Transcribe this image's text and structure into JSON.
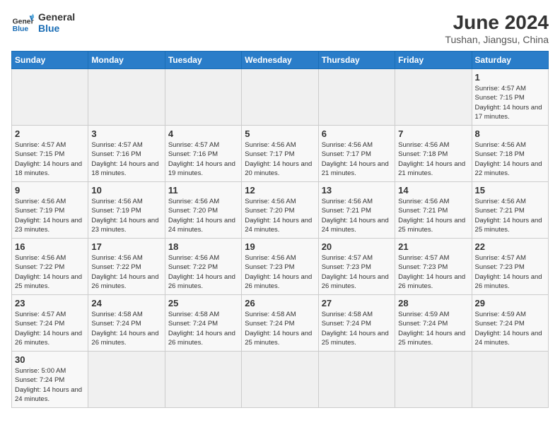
{
  "header": {
    "logo_general": "General",
    "logo_blue": "Blue",
    "title": "June 2024",
    "subtitle": "Tushan, Jiangsu, China"
  },
  "days_of_week": [
    "Sunday",
    "Monday",
    "Tuesday",
    "Wednesday",
    "Thursday",
    "Friday",
    "Saturday"
  ],
  "weeks": [
    [
      {
        "day": "",
        "info": ""
      },
      {
        "day": "",
        "info": ""
      },
      {
        "day": "",
        "info": ""
      },
      {
        "day": "",
        "info": ""
      },
      {
        "day": "",
        "info": ""
      },
      {
        "day": "",
        "info": ""
      },
      {
        "day": "1",
        "info": "Sunrise: 4:57 AM\nSunset: 7:15 PM\nDaylight: 14 hours and 17 minutes."
      }
    ],
    [
      {
        "day": "2",
        "info": "Sunrise: 4:57 AM\nSunset: 7:15 PM\nDaylight: 14 hours and 18 minutes."
      },
      {
        "day": "3",
        "info": "Sunrise: 4:57 AM\nSunset: 7:16 PM\nDaylight: 14 hours and 18 minutes."
      },
      {
        "day": "4",
        "info": "Sunrise: 4:57 AM\nSunset: 7:16 PM\nDaylight: 14 hours and 19 minutes."
      },
      {
        "day": "5",
        "info": "Sunrise: 4:56 AM\nSunset: 7:17 PM\nDaylight: 14 hours and 20 minutes."
      },
      {
        "day": "6",
        "info": "Sunrise: 4:56 AM\nSunset: 7:17 PM\nDaylight: 14 hours and 21 minutes."
      },
      {
        "day": "7",
        "info": "Sunrise: 4:56 AM\nSunset: 7:18 PM\nDaylight: 14 hours and 21 minutes."
      },
      {
        "day": "8",
        "info": "Sunrise: 4:56 AM\nSunset: 7:18 PM\nDaylight: 14 hours and 22 minutes."
      }
    ],
    [
      {
        "day": "9",
        "info": "Sunrise: 4:56 AM\nSunset: 7:19 PM\nDaylight: 14 hours and 23 minutes."
      },
      {
        "day": "10",
        "info": "Sunrise: 4:56 AM\nSunset: 7:19 PM\nDaylight: 14 hours and 23 minutes."
      },
      {
        "day": "11",
        "info": "Sunrise: 4:56 AM\nSunset: 7:20 PM\nDaylight: 14 hours and 24 minutes."
      },
      {
        "day": "12",
        "info": "Sunrise: 4:56 AM\nSunset: 7:20 PM\nDaylight: 14 hours and 24 minutes."
      },
      {
        "day": "13",
        "info": "Sunrise: 4:56 AM\nSunset: 7:21 PM\nDaylight: 14 hours and 24 minutes."
      },
      {
        "day": "14",
        "info": "Sunrise: 4:56 AM\nSunset: 7:21 PM\nDaylight: 14 hours and 25 minutes."
      },
      {
        "day": "15",
        "info": "Sunrise: 4:56 AM\nSunset: 7:21 PM\nDaylight: 14 hours and 25 minutes."
      }
    ],
    [
      {
        "day": "16",
        "info": "Sunrise: 4:56 AM\nSunset: 7:22 PM\nDaylight: 14 hours and 25 minutes."
      },
      {
        "day": "17",
        "info": "Sunrise: 4:56 AM\nSunset: 7:22 PM\nDaylight: 14 hours and 26 minutes."
      },
      {
        "day": "18",
        "info": "Sunrise: 4:56 AM\nSunset: 7:22 PM\nDaylight: 14 hours and 26 minutes."
      },
      {
        "day": "19",
        "info": "Sunrise: 4:56 AM\nSunset: 7:23 PM\nDaylight: 14 hours and 26 minutes."
      },
      {
        "day": "20",
        "info": "Sunrise: 4:57 AM\nSunset: 7:23 PM\nDaylight: 14 hours and 26 minutes."
      },
      {
        "day": "21",
        "info": "Sunrise: 4:57 AM\nSunset: 7:23 PM\nDaylight: 14 hours and 26 minutes."
      },
      {
        "day": "22",
        "info": "Sunrise: 4:57 AM\nSunset: 7:23 PM\nDaylight: 14 hours and 26 minutes."
      }
    ],
    [
      {
        "day": "23",
        "info": "Sunrise: 4:57 AM\nSunset: 7:24 PM\nDaylight: 14 hours and 26 minutes."
      },
      {
        "day": "24",
        "info": "Sunrise: 4:58 AM\nSunset: 7:24 PM\nDaylight: 14 hours and 26 minutes."
      },
      {
        "day": "25",
        "info": "Sunrise: 4:58 AM\nSunset: 7:24 PM\nDaylight: 14 hours and 26 minutes."
      },
      {
        "day": "26",
        "info": "Sunrise: 4:58 AM\nSunset: 7:24 PM\nDaylight: 14 hours and 25 minutes."
      },
      {
        "day": "27",
        "info": "Sunrise: 4:58 AM\nSunset: 7:24 PM\nDaylight: 14 hours and 25 minutes."
      },
      {
        "day": "28",
        "info": "Sunrise: 4:59 AM\nSunset: 7:24 PM\nDaylight: 14 hours and 25 minutes."
      },
      {
        "day": "29",
        "info": "Sunrise: 4:59 AM\nSunset: 7:24 PM\nDaylight: 14 hours and 24 minutes."
      }
    ],
    [
      {
        "day": "30",
        "info": "Sunrise: 5:00 AM\nSunset: 7:24 PM\nDaylight: 14 hours and 24 minutes."
      },
      {
        "day": "",
        "info": ""
      },
      {
        "day": "",
        "info": ""
      },
      {
        "day": "",
        "info": ""
      },
      {
        "day": "",
        "info": ""
      },
      {
        "day": "",
        "info": ""
      },
      {
        "day": "",
        "info": ""
      }
    ]
  ]
}
